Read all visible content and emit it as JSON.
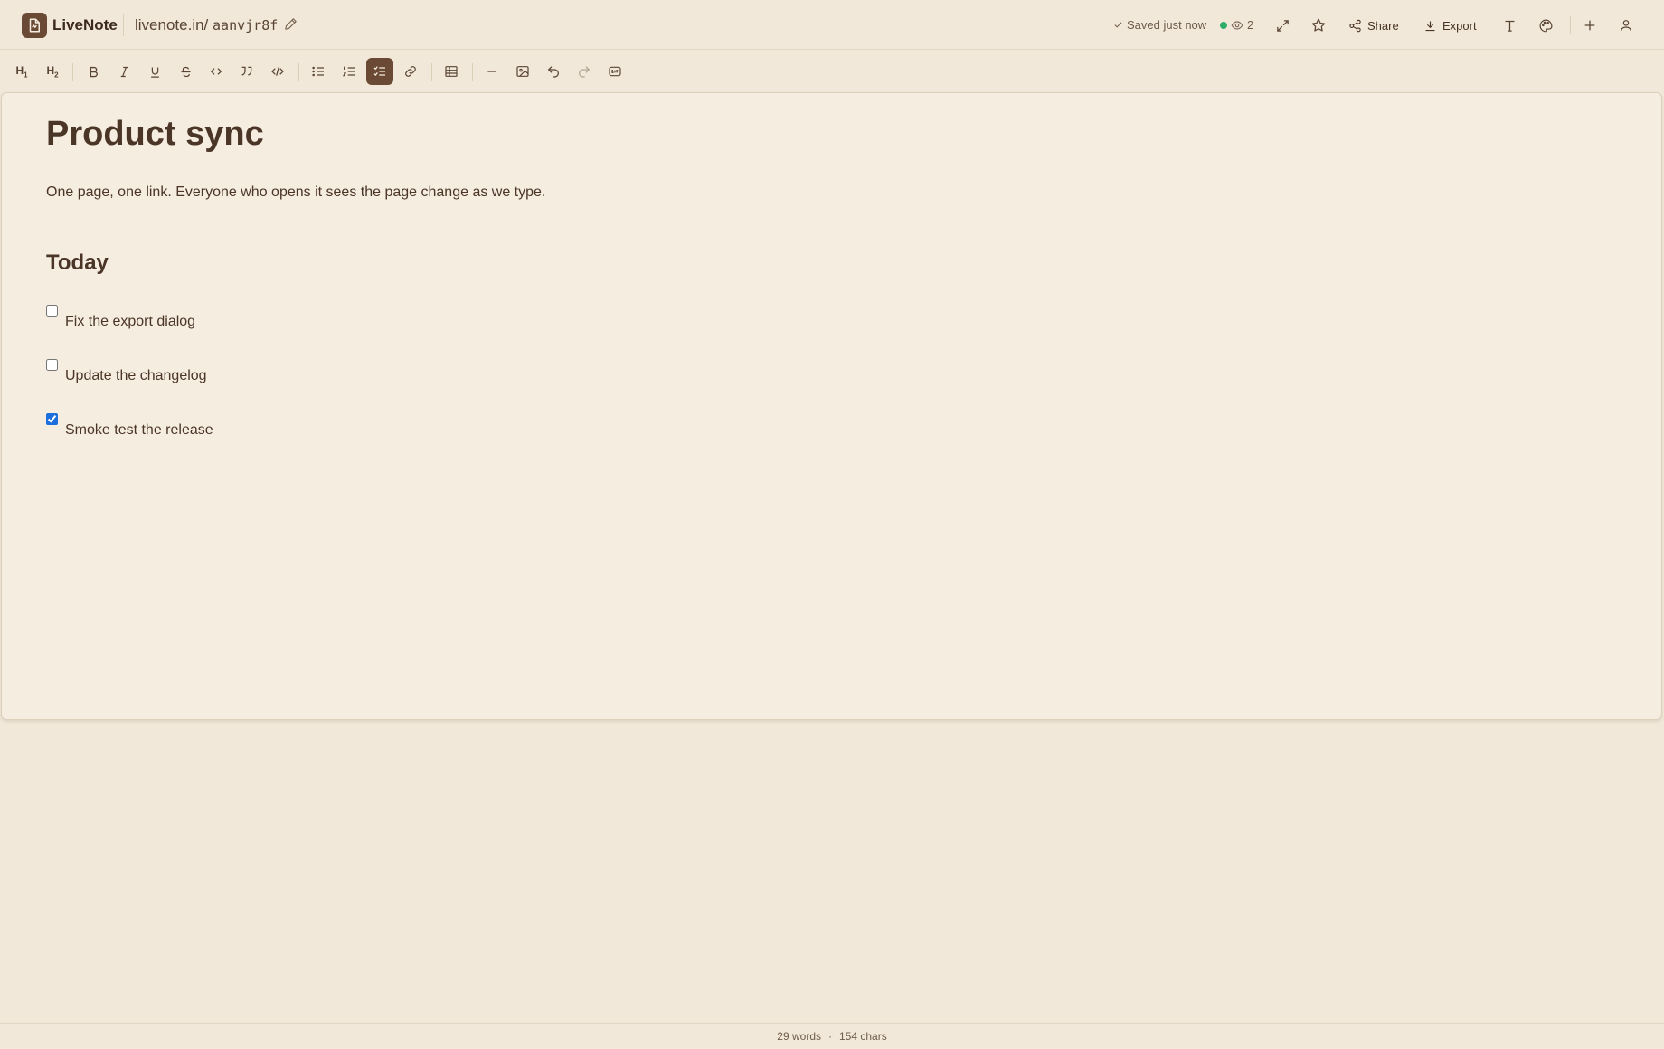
{
  "app": {
    "name": "LiveNote",
    "url_prefix": "livenote.in/",
    "url_slug": "aanvjr8f"
  },
  "header": {
    "save_status": "Saved just now",
    "viewer_count": "2",
    "share_label": "Share",
    "export_label": "Export"
  },
  "document": {
    "title": "Product sync",
    "intro": "One page, one link. Everyone who opens it sees the page change as we type.",
    "section_heading": "Today",
    "tasks": [
      {
        "label": "Fix the export dialog",
        "checked": false
      },
      {
        "label": "Update the changelog",
        "checked": false
      },
      {
        "label": "Smoke test the release",
        "checked": true
      }
    ]
  },
  "status": {
    "words": "29 words",
    "separator": "·",
    "chars": "154 chars"
  },
  "colors": {
    "accent": "#6a4a35",
    "background": "#f1e8d9",
    "editor_background": "#f5ede0",
    "presence_dot": "#2fae6a"
  }
}
